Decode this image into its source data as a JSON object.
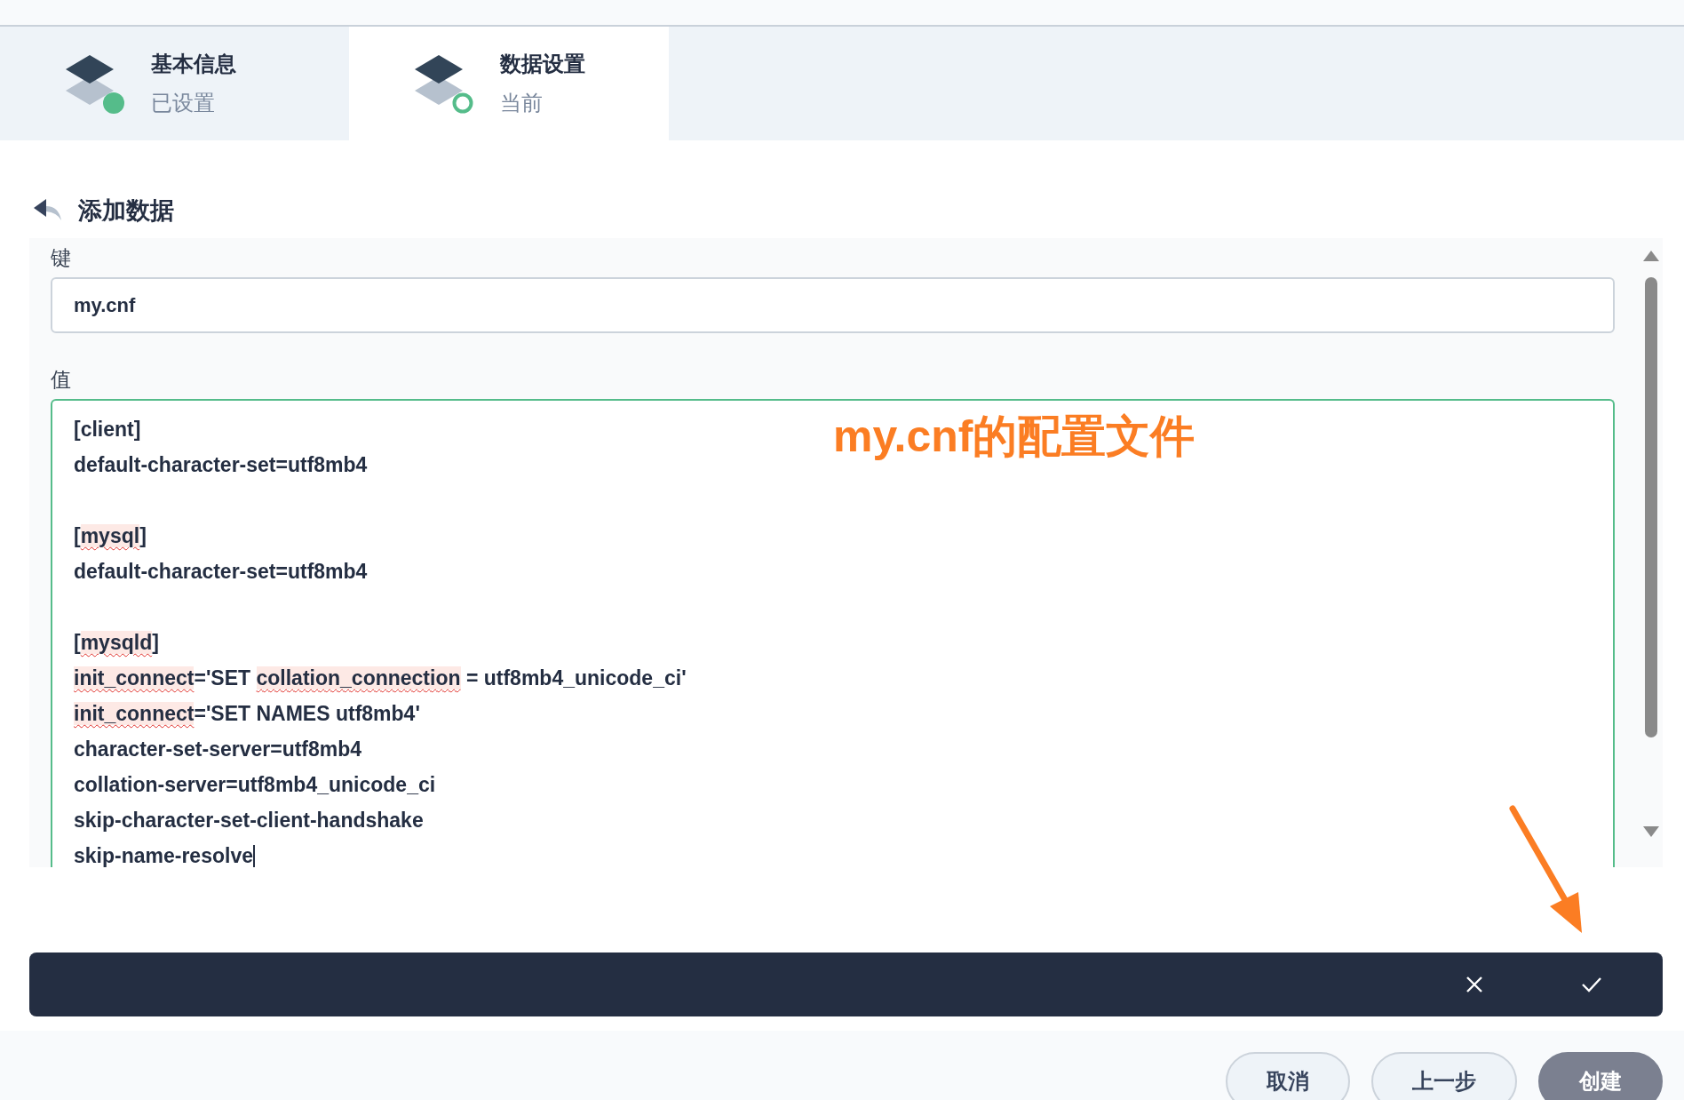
{
  "steps": [
    {
      "title": "基本信息",
      "status": "已设置",
      "done": true,
      "selected": false
    },
    {
      "title": "数据设置",
      "status": "当前",
      "done": false,
      "selected": true
    }
  ],
  "heading": "添加数据",
  "key_field": {
    "label": "键",
    "value": "my.cnf"
  },
  "value_field": {
    "label": "值",
    "lines": [
      {
        "kind": "text",
        "segments": [
          {
            "text": "[client]",
            "misspelled": false
          }
        ]
      },
      {
        "kind": "text",
        "segments": [
          {
            "text": "default-character-set=utf8mb4",
            "misspelled": false
          }
        ]
      },
      {
        "kind": "blank"
      },
      {
        "kind": "text",
        "segments": [
          {
            "text": "[",
            "misspelled": false
          },
          {
            "text": "mysql",
            "misspelled": true
          },
          {
            "text": "]",
            "misspelled": false
          }
        ]
      },
      {
        "kind": "text",
        "segments": [
          {
            "text": "default-character-set=utf8mb4",
            "misspelled": false
          }
        ]
      },
      {
        "kind": "blank"
      },
      {
        "kind": "text",
        "segments": [
          {
            "text": "[",
            "misspelled": false
          },
          {
            "text": "mysqld",
            "misspelled": true
          },
          {
            "text": "]",
            "misspelled": false
          }
        ]
      },
      {
        "kind": "text",
        "segments": [
          {
            "text": "init_connect",
            "misspelled": true
          },
          {
            "text": "='SET ",
            "misspelled": false
          },
          {
            "text": "collation_connection",
            "misspelled": true
          },
          {
            "text": " = utf8mb4_unicode_ci'",
            "misspelled": false
          }
        ]
      },
      {
        "kind": "text",
        "segments": [
          {
            "text": "init_connect",
            "misspelled": true
          },
          {
            "text": "='SET NAMES utf8mb4'",
            "misspelled": false
          }
        ]
      },
      {
        "kind": "text",
        "segments": [
          {
            "text": "character-set-server=utf8mb4",
            "misspelled": false
          }
        ]
      },
      {
        "kind": "text",
        "segments": [
          {
            "text": "collation-server=utf8mb4_unicode_ci",
            "misspelled": false
          }
        ]
      },
      {
        "kind": "text",
        "segments": [
          {
            "text": "skip-character-set-client-handshake",
            "misspelled": false
          }
        ]
      },
      {
        "kind": "text",
        "segments": [
          {
            "text": "skip-name-resolve",
            "misspelled": false
          }
        ],
        "cursor": true
      }
    ]
  },
  "annotation": "my.cnf的配置文件",
  "footer_buttons": [
    {
      "label": "取消",
      "kind": "outline"
    },
    {
      "label": "上一步",
      "kind": "outline"
    },
    {
      "label": "创建",
      "kind": "primary"
    }
  ]
}
